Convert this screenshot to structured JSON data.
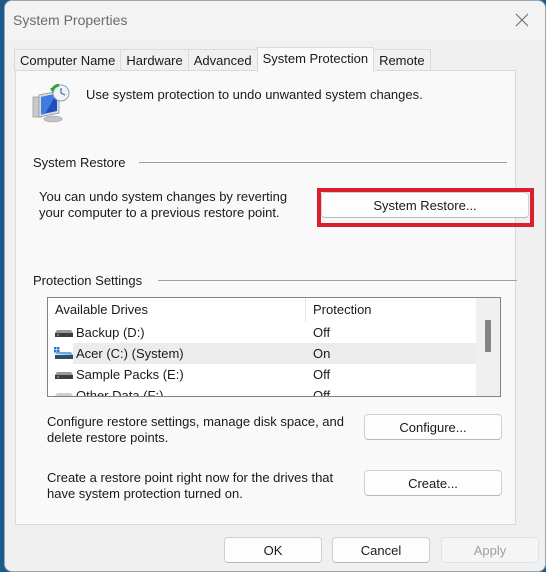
{
  "window": {
    "title": "System Properties",
    "close_icon": "close-icon"
  },
  "tabs": [
    {
      "label": "Computer Name",
      "active": false
    },
    {
      "label": "Hardware",
      "active": false
    },
    {
      "label": "Advanced",
      "active": false
    },
    {
      "label": "System Protection",
      "active": true
    },
    {
      "label": "Remote",
      "active": false
    }
  ],
  "intro": {
    "icon": "system-protection-icon",
    "text": "Use system protection to undo unwanted system changes."
  },
  "system_restore": {
    "group_label": "System Restore",
    "description_line1": "You can undo system changes by reverting",
    "description_line2": "your computer to a previous restore point.",
    "button_label": "System Restore...",
    "highlight_color": "#d9202f"
  },
  "protection_settings": {
    "group_label": "Protection Settings",
    "columns": [
      "Available Drives",
      "Protection"
    ],
    "drives": [
      {
        "name": "Backup (D:)",
        "protection": "Off",
        "icon": "hard-drive-icon",
        "selected": false
      },
      {
        "name": "Acer (C:) (System)",
        "protection": "On",
        "icon": "system-drive-icon",
        "selected": true
      },
      {
        "name": "Sample Packs (E:)",
        "protection": "Off",
        "icon": "hard-drive-icon",
        "selected": false
      },
      {
        "name": "Other Data (F:)",
        "protection": "Off",
        "icon": "hard-drive-icon",
        "selected": false
      }
    ],
    "configure": {
      "description_line1": "Configure restore settings, manage disk space, and",
      "description_line2": "delete restore points.",
      "button_label": "Configure..."
    },
    "create": {
      "description_line1": "Create a restore point right now for the drives that",
      "description_line2": "have system protection turned on.",
      "button_label": "Create..."
    }
  },
  "footer": {
    "ok_label": "OK",
    "cancel_label": "Cancel",
    "apply_label": "Apply",
    "apply_enabled": false
  }
}
